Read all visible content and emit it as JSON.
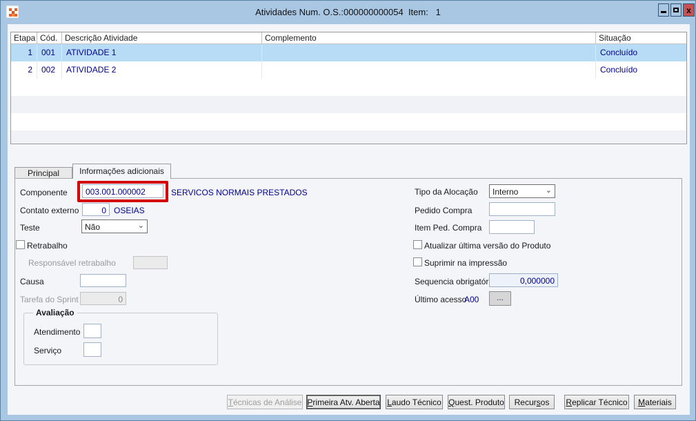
{
  "window": {
    "title": "Atividades Num. O.S.:000000000054  Item:   1",
    "close_icon_glyph": "x"
  },
  "colors": {
    "titlebar": "#a9c6e3",
    "selected_row": "#b9dcf6",
    "highlight_box": "#d40000",
    "value_text": "#00008b",
    "close_button": "#c75050"
  },
  "table": {
    "columns": [
      {
        "label": "Etapa"
      },
      {
        "label": "Cód."
      },
      {
        "label": "Descrição Atividade"
      },
      {
        "label": "Complemento"
      },
      {
        "label": "Situação"
      }
    ],
    "rows": [
      {
        "etapa": "1",
        "cod": "001",
        "descricao": "ATIVIDADE 1",
        "complemento": "",
        "situacao": "Concluído",
        "selected": true
      },
      {
        "etapa": "2",
        "cod": "002",
        "descricao": "ATIVIDADE 2",
        "complemento": "",
        "situacao": "Concluído",
        "selected": false
      }
    ]
  },
  "tabs": {
    "principal": "Principal",
    "adicionais": "Informações adicionais"
  },
  "form": {
    "componente": {
      "label": "Componente",
      "value": "003.001.000002",
      "description": "SERVICOS NORMAIS PRESTADOS"
    },
    "contato_externo": {
      "label": "Contato externo",
      "value": "0",
      "description": "OSEIAS"
    },
    "teste": {
      "label": "Teste",
      "value": "Não"
    },
    "retrabalho": {
      "label": "Retrabalho",
      "checked": false
    },
    "responsavel_retrabalho": {
      "label": "Responsável retrabalho",
      "value": ""
    },
    "causa": {
      "label": "Causa",
      "value": ""
    },
    "tarefa_sprint": {
      "label": "Tarefa do Sprint",
      "value": "0"
    },
    "avaliacao": {
      "label": "Avaliação",
      "atendimento": {
        "label": "Atendimento",
        "value": ""
      },
      "servico": {
        "label": "Serviço",
        "value": ""
      }
    },
    "tipo_alocacao": {
      "label": "Tipo da Alocação",
      "value": "Interno"
    },
    "pedido_compra": {
      "label": "Pedido Compra",
      "value": ""
    },
    "item_ped_compra": {
      "label": "Item Ped. Compra",
      "value": ""
    },
    "atualizar_ultima_versao": {
      "label": "Atualizar última versão do Produto",
      "checked": false
    },
    "suprimir_impressao": {
      "label": "Suprimir na impressão",
      "checked": false
    },
    "sequencia_obrigatoria": {
      "label": "Sequencia obrigatória",
      "value": "0,000000"
    },
    "ultimo_acesso": {
      "label": "Último acesso",
      "value": "A00",
      "browse_label": "..."
    }
  },
  "buttons": [
    {
      "pre": "",
      "mn": "T",
      "post": "écnicas de Análise",
      "disabled": true
    },
    {
      "pre": "",
      "mn": "P",
      "post": "rimeira Atv. Aberta",
      "disabled": false
    },
    {
      "pre": "",
      "mn": "L",
      "post": "audo Técnico",
      "disabled": false
    },
    {
      "pre": "",
      "mn": "Q",
      "post": "uest. Produto",
      "disabled": false
    },
    {
      "pre": "Recur",
      "mn": "s",
      "post": "os",
      "disabled": false
    },
    {
      "pre": "",
      "mn": "R",
      "post": "eplicar Técnico",
      "disabled": false
    },
    {
      "pre": "",
      "mn": "M",
      "post": "ateriais",
      "disabled": false
    }
  ]
}
